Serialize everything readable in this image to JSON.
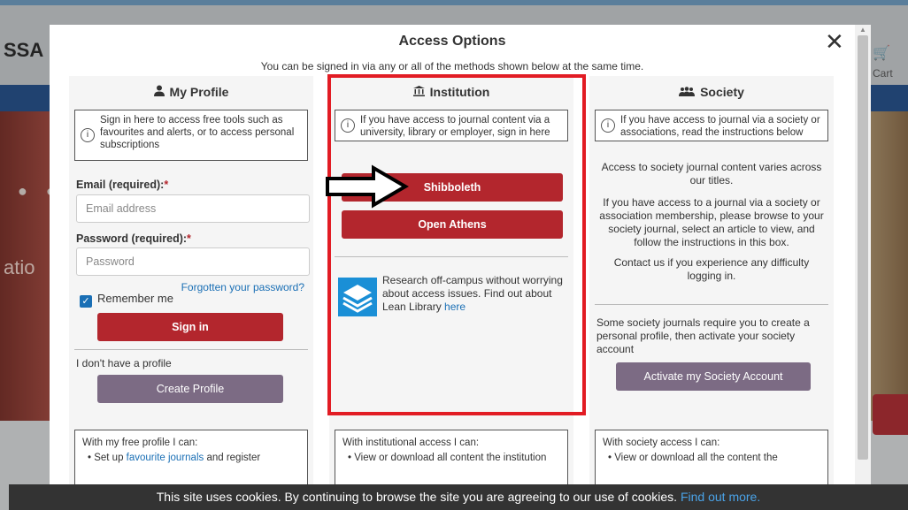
{
  "background": {
    "logo": "SSA",
    "hero_text": "atio",
    "cart_label": "Cart"
  },
  "modal": {
    "title": "Access Options",
    "close": "✕",
    "subtitle": "You can be signed in via any or all of the methods shown below at the same time."
  },
  "profile": {
    "icon": "person-icon",
    "heading": "My Profile",
    "info": "Sign in here to access free tools such as favourites and alerts, or to access personal subscriptions",
    "email_label": "Email (required):",
    "email_placeholder": "Email address",
    "password_label": "Password (required):",
    "password_placeholder": "Password",
    "required_mark": "*",
    "forgot": "Forgotten your password?",
    "remember": "Remember me",
    "remember_checked": true,
    "sign_in": "Sign in",
    "no_profile": "I don't have a profile",
    "create": "Create Profile",
    "free_heading": "With my free profile I can:",
    "free_item_prefix": "• Set up ",
    "free_item_link": "favourite journals",
    "free_item_suffix": " and register"
  },
  "institution": {
    "icon": "institution-icon",
    "heading": "Institution",
    "info": "If you have access to journal content via a university, library or employer, sign in here",
    "shibboleth": "Shibboleth",
    "open_athens": "Open Athens",
    "lean_text": "Research off-campus without worrying about access issues. Find out about Lean Library ",
    "lean_link": "here",
    "access_heading": "With institutional access I can:",
    "access_item": "• View or download all content the institution"
  },
  "society": {
    "icon": "group-icon",
    "heading": "Society",
    "info": "If you have access to journal via a society or associations, read the instructions below",
    "p1": "Access to society journal content varies across our titles.",
    "p2": "If you have access to a journal via a society or association membership, please browse to your society journal, select an article to view, and follow the instructions in this box.",
    "p3": "Contact us if you experience any difficulty logging in.",
    "p4": "Some society journals require you to create a personal profile, then activate your society account",
    "activate": "Activate my Society Account",
    "access_heading": "With society access I can:",
    "access_item": "• View or download all the content the"
  },
  "cookie": {
    "text": "This site uses cookies. By continuing to browse the site you are agreeing to our use of cookies. ",
    "link": "Find out more."
  },
  "colors": {
    "accent_red": "#b3262d",
    "highlight_red": "#e21c24",
    "link_blue": "#1a6fb5",
    "grey_button": "#7c6b84"
  }
}
